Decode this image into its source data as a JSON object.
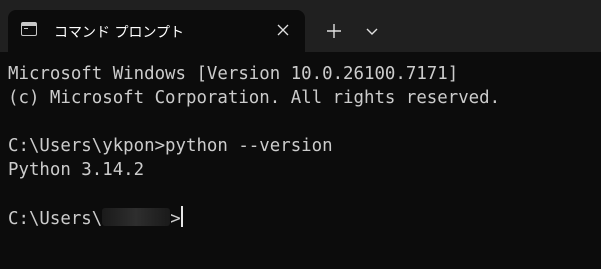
{
  "tab": {
    "title": "コマンド プロンプト",
    "icon": "terminal-icon",
    "close_icon": "close-icon"
  },
  "toolbar": {
    "new_tab_icon": "plus-icon",
    "dropdown_icon": "chevron-down-icon"
  },
  "console": {
    "lines": [
      "Microsoft Windows [Version 10.0.26100.7171]",
      "(c) Microsoft Corporation. All rights reserved.",
      "",
      "C:\\Users\\ykpon>python --version",
      "Python 3.14.2",
      ""
    ],
    "prompt_prefix": "C:\\Users\\",
    "prompt_suffix": ">"
  },
  "colors": {
    "background": "#0c0c0c",
    "titlebar": "#202020",
    "text": "#cccccc"
  }
}
